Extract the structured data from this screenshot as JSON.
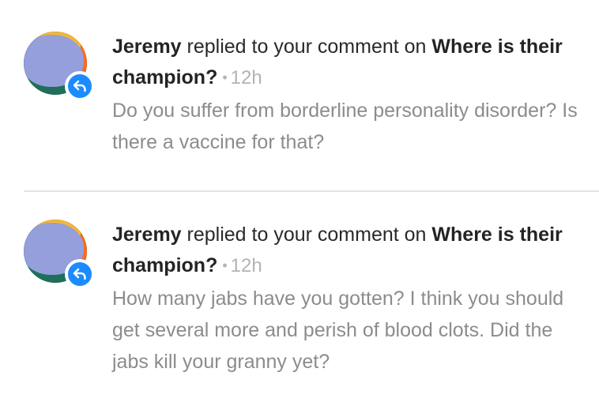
{
  "notifications": [
    {
      "user": "Jeremy",
      "action_text": "replied to your comment on",
      "post_title": "Where is their champion?",
      "time": "12h",
      "comment": "Do you suffer from borderline personality disorder? Is there a vaccine for that?",
      "badge_icon": "reply-arrow",
      "badge_color": "#1a8cff"
    },
    {
      "user": "Jeremy",
      "action_text": "replied to your comment on",
      "post_title": "Where is their champion?",
      "time": "12h",
      "comment": "How many jabs have you gotten? I think you should get several more and perish of blood clots. Did the jabs kill your granny yet?",
      "badge_icon": "reply-arrow",
      "badge_color": "#1a8cff"
    }
  ],
  "separator": "•"
}
